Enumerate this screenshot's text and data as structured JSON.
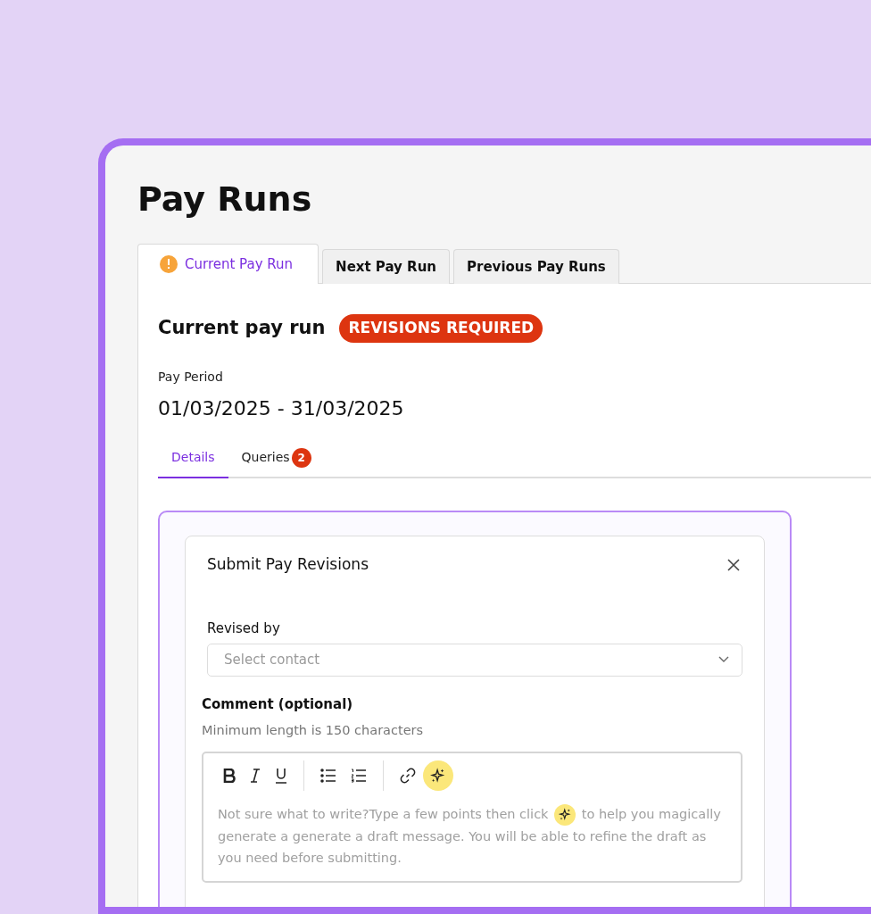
{
  "page_title": "Pay Runs",
  "tabs": [
    {
      "label": "Current Pay Run",
      "selected": true,
      "warning": true
    },
    {
      "label": "Next Pay Run",
      "selected": false,
      "warning": false
    },
    {
      "label": "Previous Pay Runs",
      "selected": false,
      "warning": false
    }
  ],
  "heading": "Current pay run",
  "status_badge": "REVISIONS REQUIRED",
  "pay_period": {
    "label": "Pay Period",
    "value": "01/03/2025 - 31/03/2025"
  },
  "subtabs": [
    {
      "label": "Details",
      "selected": true
    },
    {
      "label": "Queries",
      "selected": false,
      "count": "2"
    }
  ],
  "dialog": {
    "title": "Submit Pay Revisions",
    "revised_by": {
      "label": "Revised by",
      "placeholder": "Select contact"
    },
    "comment": {
      "label": "Comment (optional)",
      "hint": "Minimum length is 150 characters",
      "toolbar": [
        {
          "kind": "bold"
        },
        {
          "kind": "italic"
        },
        {
          "kind": "underline"
        },
        {
          "kind": "separator"
        },
        {
          "kind": "bullets"
        },
        {
          "kind": "numbered"
        },
        {
          "kind": "separator"
        },
        {
          "kind": "link"
        },
        {
          "kind": "magic"
        }
      ],
      "placeholder_before": "Not sure what to write?Type a few points then click",
      "placeholder_after": "to help you magically generate a generate a draft message. You will be able to refine the draft as you need before submitting."
    }
  }
}
